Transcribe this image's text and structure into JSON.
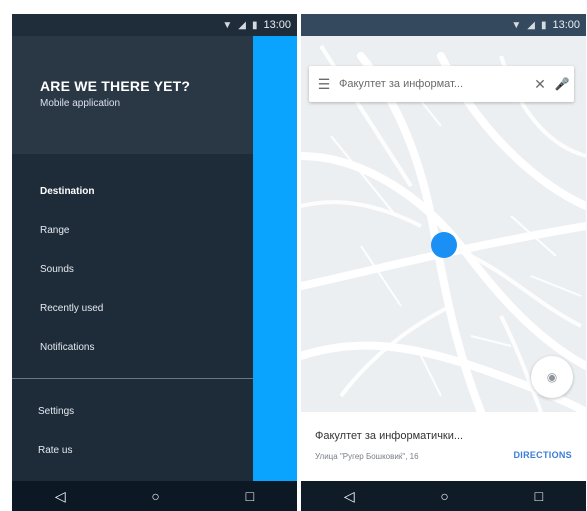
{
  "status": {
    "time": "13:00",
    "icons": [
      "wifi-icon",
      "signal-icon",
      "battery-icon"
    ]
  },
  "left_phone": {
    "header": {
      "title": "ARE WE THERE YET?",
      "subtitle": "Mobile application"
    },
    "menu": [
      {
        "label": "Destination",
        "active": true
      },
      {
        "label": "Range"
      },
      {
        "label": "Sounds"
      },
      {
        "label": "Recently used"
      },
      {
        "label": "Notifications"
      }
    ],
    "footer": [
      {
        "label": "Settings"
      },
      {
        "label": "Rate us"
      }
    ],
    "colors": {
      "drawer": "#1e2c3a",
      "header": "#2a3846",
      "accent": "#0aa4ff"
    }
  },
  "right_phone": {
    "search": {
      "text": "Факултет за информат..."
    },
    "place": {
      "name": "Факултет за информатички...",
      "address": "Улица \"Ругер Бошковиќ\", 16",
      "directions_label": "DIRECTIONS"
    },
    "colors": {
      "dot": "#1a90f5",
      "fab": "#2b3640",
      "link": "#3b7dd8"
    }
  },
  "navbar": {
    "back_icon": "◁",
    "home_icon": "○",
    "recent_icon": "□"
  }
}
